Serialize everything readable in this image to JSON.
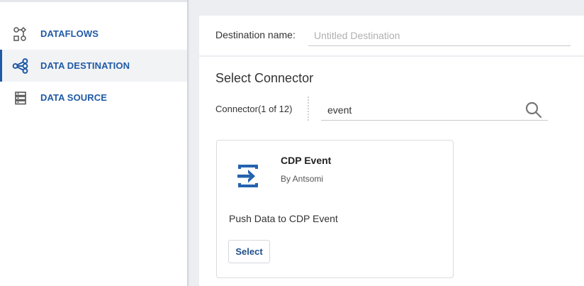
{
  "sidebar": {
    "items": [
      {
        "label": "DATAFLOWS",
        "icon": "dataflows-icon",
        "active": false
      },
      {
        "label": "DATA DESTINATION",
        "icon": "share-nodes-icon",
        "active": true
      },
      {
        "label": "DATA SOURCE",
        "icon": "server-stack-icon",
        "active": false
      }
    ]
  },
  "destination": {
    "label": "Destination name:",
    "placeholder": "Untitled Destination",
    "value": ""
  },
  "connector_section": {
    "title": "Select Connector",
    "count_label": "Connector(1 of 12)",
    "search_value": "event"
  },
  "connectors": [
    {
      "title": "CDP Event",
      "by": "By Antsomi",
      "description": "Push Data to CDP Event",
      "select_label": "Select",
      "icon": "import-arrow-icon"
    }
  ],
  "colors": {
    "accent": "#1f5aa6",
    "background": "#eceef2",
    "select_text": "#1f4e8c"
  }
}
